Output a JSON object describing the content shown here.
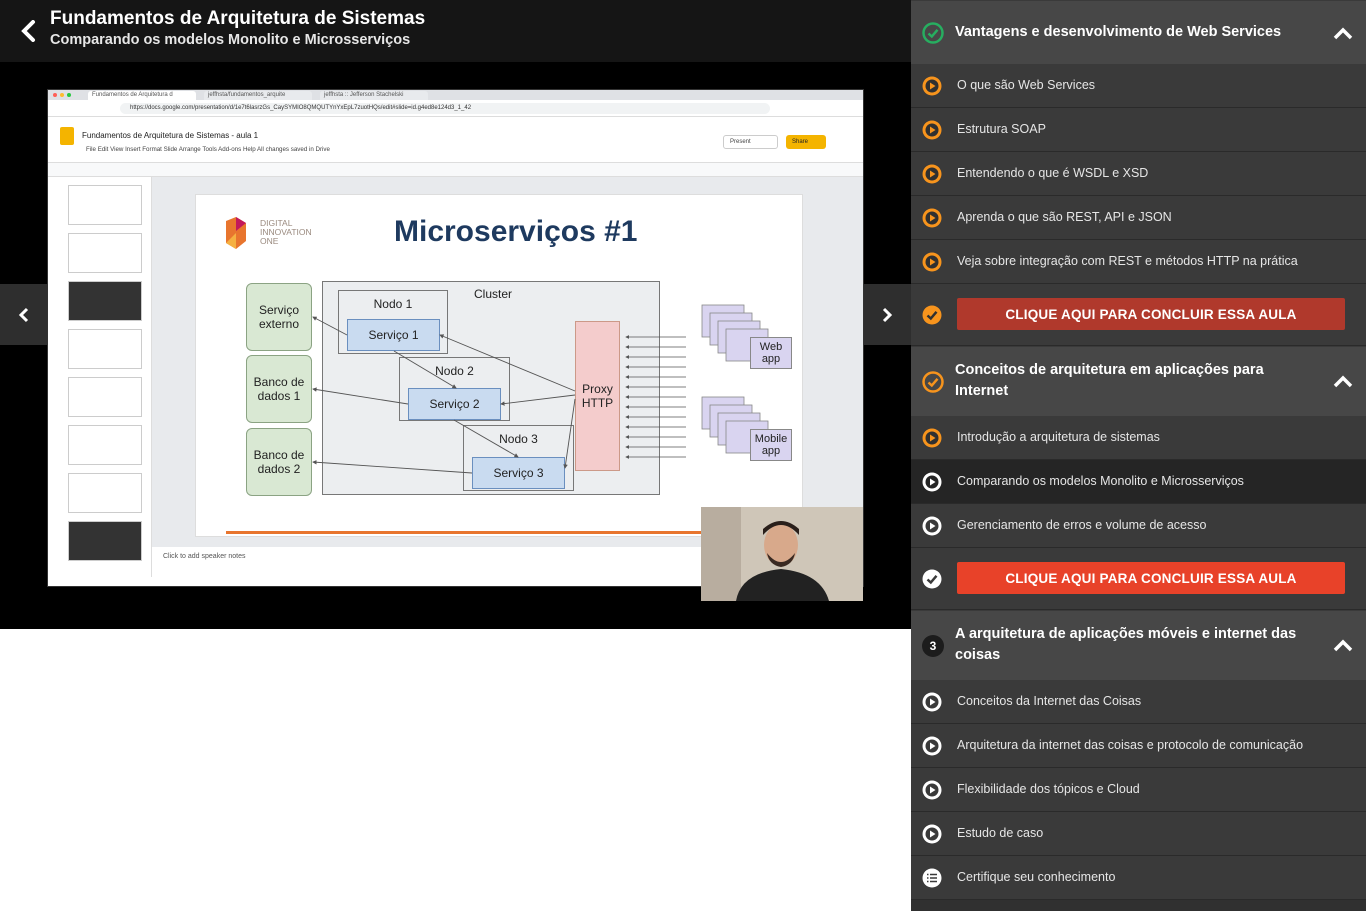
{
  "header": {
    "title": "Fundamentos de Arquitetura de Sistemas",
    "subtitle": "Comparando os modelos Monolito e Microsserviços"
  },
  "video": {
    "browser_tabs": [
      "Fundamentos de Arquitetura d",
      "jeffhsta/fundamentos_arquite",
      "jeffhsta :: Jefferson Stachelski"
    ],
    "url": "https://docs.google.com/presentation/d/1e7t6lasrzGs_CaySYMIO8QMQUTYnYxEpL7zuotHQs/edit#slide=id.g4ed8e124d3_1_42",
    "doc_title": "Fundamentos de Arquitetura de Sistemas - aula 1",
    "doc_menu": "File   Edit   View   Insert   Format   Slide   Arrange   Tools   Add-ons   Help      All changes saved in Drive",
    "present_label": "Present",
    "share_label": "Share",
    "slide": {
      "logo_text": "DIGITAL\nINNOVATION\nONE",
      "title": "Microserviços #1",
      "cluster_label": "Cluster",
      "nodes": [
        "Nodo 1",
        "Nodo 2",
        "Nodo 3"
      ],
      "services": [
        "Serviço 1",
        "Serviço 2",
        "Serviço 3"
      ],
      "left_boxes": [
        "Serviço externo",
        "Banco de dados 1",
        "Banco de dados 2"
      ],
      "proxy": "Proxy HTTP",
      "web_app": "Web app",
      "mobile_app": "Mobile app"
    },
    "speaker_notes": "Click to add speaker notes"
  },
  "sections": [
    {
      "title": "Vantagens e desenvolvimento de Web Services",
      "status": "completed",
      "lessons": [
        "O que são Web Services",
        "Estrutura SOAP",
        "Entendendo o que é WSDL e XSD",
        "Aprenda o que são REST, API e JSON",
        "Veja sobre integração com REST e métodos HTTP na prática"
      ],
      "cta": "CLIQUE AQUI PARA CONCLUIR ESSA AULA"
    },
    {
      "title": "Conceitos de arquitetura em aplicações para Internet",
      "status": "in-progress",
      "lessons": [
        "Introdução a arquitetura de sistemas",
        "Comparando os modelos Monolito e Microsserviços",
        "Gerenciamento de erros e volume de acesso"
      ],
      "cta": "CLIQUE AQUI PARA CONCLUIR ESSA AULA"
    },
    {
      "number": "3",
      "title": "A arquitetura de aplicações móveis e internet das coisas",
      "lessons": [
        "Conceitos da Internet das Coisas",
        "Arquitetura da internet das coisas e protocolo de comunicação",
        "Flexibilidade dos tópicos e Cloud",
        "Estudo de caso",
        "Certifique seu conhecimento"
      ]
    }
  ],
  "colors": {
    "accent_orange": "#f7941d",
    "cta_dim": "#b0392c",
    "cta_active": "#e84229",
    "check_green": "#27ae60"
  }
}
